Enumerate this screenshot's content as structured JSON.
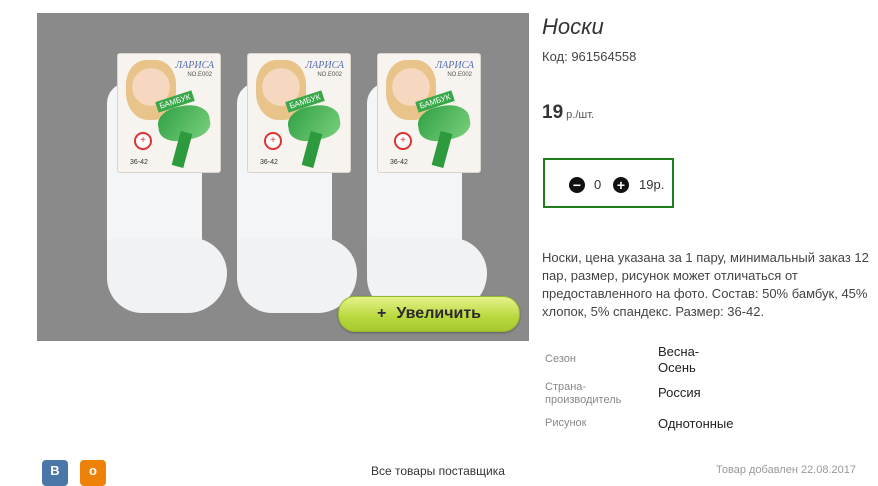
{
  "image": {
    "zoom_label": "Увеличить",
    "packs": [
      {
        "brand": "ЛАРИСА",
        "code": "NO.E002",
        "bamboo": "БАМБУК",
        "size": "36-42"
      },
      {
        "brand": "ЛАРИСА",
        "code": "NO.E002",
        "bamboo": "БАМБУК",
        "size": "36-42"
      },
      {
        "brand": "ЛАРИСА",
        "code": "NO.E002",
        "bamboo": "БАМБУК",
        "size": "36-42"
      }
    ]
  },
  "product": {
    "title": "Носки",
    "code": "Код: 961564558",
    "price_value": "19",
    "price_unit": "р./шт.",
    "quantity": "0",
    "total": "19р.",
    "description": "Носки, цена указана за 1 пару, минимальный заказ 12 пар, размер, рисунок может отличаться от предоставленного на фото. Состав: 50% бамбук, 45% хлопок, 5% спандекс. Размер: 36-42."
  },
  "attributes": [
    {
      "label": "Сезон",
      "value": "Весна-Осень"
    },
    {
      "label": "Страна-производитель",
      "value": "Россия"
    },
    {
      "label": "Рисунок",
      "value": "Однотонные"
    }
  ],
  "footer": {
    "vk_icon": "В",
    "ok_icon": "о",
    "supplier_link": "Все товары поставщика",
    "added_date": "Товар добавлен 22.08.2017"
  },
  "colors": {
    "accent_border": "#1e7e1e",
    "zoom_button": "#b8d83d"
  }
}
